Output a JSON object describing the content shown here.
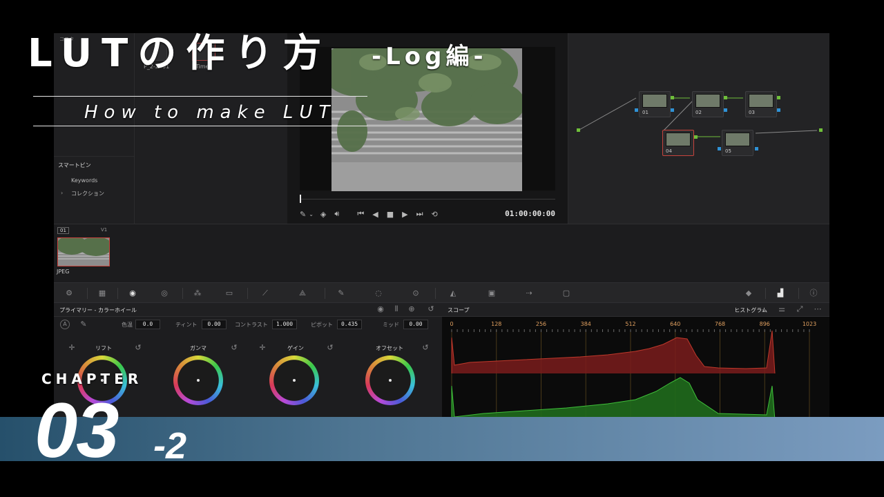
{
  "overlay": {
    "title": "LUTの作り方",
    "title_suffix": "-Log編-",
    "subtitle": "How to make LUT",
    "chapter_label": "CHAPTER",
    "chapter_number": "03",
    "chapter_sub": "-2",
    "bar_colors": [
      "#26506b",
      "#4e7592",
      "#7b9cc0"
    ]
  },
  "media_pool": {
    "title": "コスタ",
    "items": [
      "P_2-2201",
      "Timeli"
    ],
    "smart_bin_header": "スマートビン",
    "smart_bins": [
      "Keywords",
      "コレクション"
    ]
  },
  "viewer": {
    "timecode": "01:00:00:00"
  },
  "nodes": [
    {
      "label": "01"
    },
    {
      "label": "02"
    },
    {
      "label": "03"
    },
    {
      "label": "04"
    },
    {
      "label": "05"
    }
  ],
  "timeline": {
    "clip_number": "01",
    "track": "V1",
    "clip_label": "JPEG"
  },
  "primaries": {
    "panel_title": "プライマリー - カラーホイール",
    "params": [
      {
        "label": "色温",
        "value": "0.0"
      },
      {
        "label": "ティント",
        "value": "0.00"
      },
      {
        "label": "コントラスト",
        "value": "1.000"
      },
      {
        "label": "ピボット",
        "value": "0.435"
      },
      {
        "label": "ミッド",
        "value": "0.00"
      }
    ],
    "wheels": [
      {
        "label": "リフト"
      },
      {
        "label": "ガンマ"
      },
      {
        "label": "ゲイン"
      },
      {
        "label": "オフセット"
      }
    ]
  },
  "scope": {
    "title": "スコープ",
    "mode": "ヒストグラム",
    "ticks": [
      "0",
      "128",
      "256",
      "384",
      "512",
      "640",
      "768",
      "896",
      "1023"
    ],
    "channel_colors": [
      "#c0392b",
      "#3fbf3a"
    ]
  }
}
